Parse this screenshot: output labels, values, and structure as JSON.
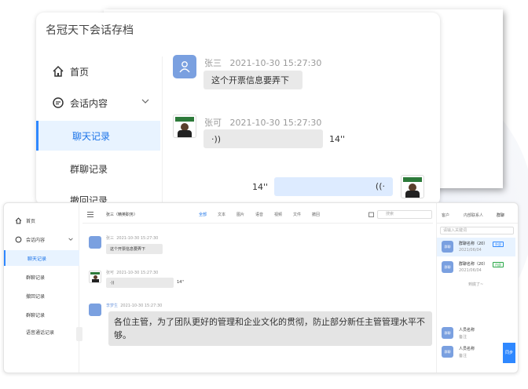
{
  "app": {
    "title": "名冠天下会话存档"
  },
  "nav": {
    "home": "首页",
    "conversation": "会话内容",
    "chat_record": "聊天记录",
    "group_record": "群聊记录",
    "recall_record": "撤回记录",
    "group_msg": "群聊记录",
    "voice_call": "语音通话记录"
  },
  "messages": [
    {
      "sender": "张三",
      "time": "2021-10-30 15:27:30",
      "text": "这个开票信息要弄下"
    },
    {
      "sender": "张可",
      "time": "2021-10-30 15:27:30",
      "voice_icon": "·))",
      "duration": "14''"
    },
    {
      "duration": "14''",
      "voice_icon": "((·"
    }
  ],
  "small": {
    "header": {
      "contact": "张三（精英职务）",
      "tabs": [
        "全部",
        "文本",
        "图片",
        "语音",
        "视频",
        "文件",
        "撤回"
      ],
      "search_placeholder": "搜索",
      "right_tabs": [
        "客户",
        "内部联系人",
        "群聊"
      ]
    },
    "messages": [
      {
        "sender": "张三",
        "time": "2021-10-30 15:27:30",
        "text": "这个开票信息要弄下"
      },
      {
        "sender": "张可",
        "time": "2021-10-30 15:27:30",
        "voice_icon": "·))",
        "duration": "14''"
      },
      {
        "sender": "李梦生",
        "time": "2021-10-30 15:27:30",
        "text": "各位主管，为了团队更好的管理和企业文化的贯彻，防止部分新任主管管理水平不够。"
      }
    ],
    "right": {
      "search_placeholder": "请输入关键词",
      "cards": [
        {
          "avatar": "群聊",
          "name": "群聊名称（20）",
          "date": "2021/06/04",
          "tag": "外部"
        },
        {
          "avatar": "群聊",
          "name": "群聊名称（20）",
          "date": "2021/06/04",
          "tag": "内部"
        }
      ],
      "more": "到底了~",
      "people": [
        {
          "avatar": "群聊",
          "name": "人员名称",
          "note": "备注"
        },
        {
          "avatar": "群聊",
          "name": "人员名称",
          "note": "备注"
        }
      ],
      "sync": "同步"
    }
  },
  "colors": {
    "accent": "#2f88ff",
    "active_bg": "#e8f3ff",
    "bubble": "#e9e9e9",
    "avatar": "#7aa0e0"
  }
}
